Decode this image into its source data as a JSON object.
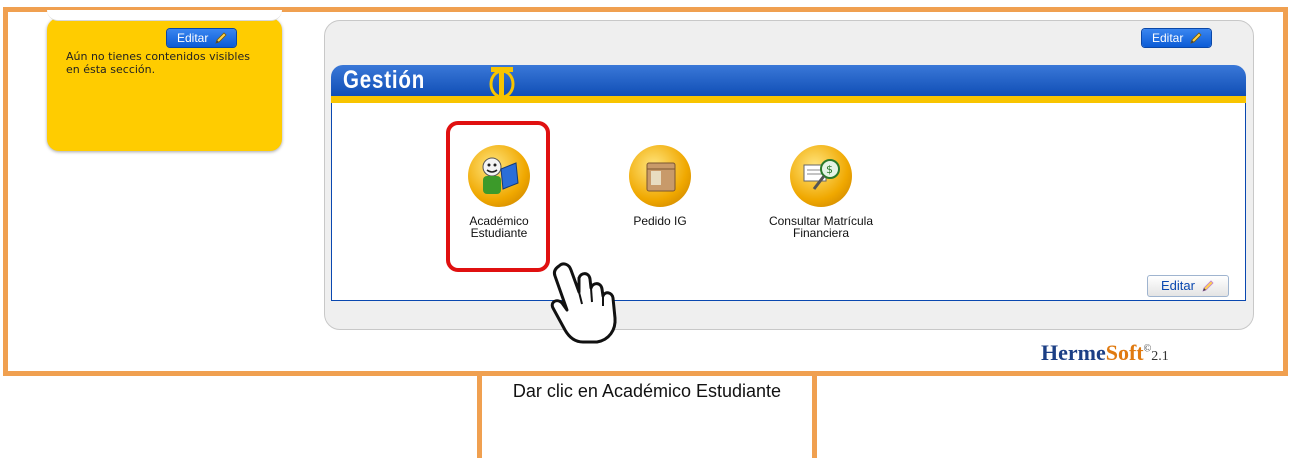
{
  "sidebar_widget": {
    "edit_label": "Editar",
    "empty_message": "Aún no tienes contenidos visibles en ésta sección."
  },
  "panel": {
    "edit_top_label": "Editar",
    "header_title": "Gestión",
    "edit_bottom_label": "Editar",
    "modules": [
      {
        "label": "Académico Estudiante",
        "icon": "student-book-icon"
      },
      {
        "label": "Pedido IG",
        "icon": "box-package-icon"
      },
      {
        "label": "Consultar Matrícula Financiera",
        "icon": "money-search-icon"
      }
    ]
  },
  "brand": {
    "name_part1": "Herme",
    "name_part2": "Soft",
    "version": "2.1",
    "copyright": "©"
  },
  "annotation": {
    "callout_text": "Dar clic en Académico Estudiante"
  },
  "colors": {
    "frame_border": "#f0a050",
    "widget_yellow": "#ffcc00",
    "header_blue": "#0a48b0",
    "header_accent": "#f8c400",
    "highlight_red": "#e01010"
  }
}
